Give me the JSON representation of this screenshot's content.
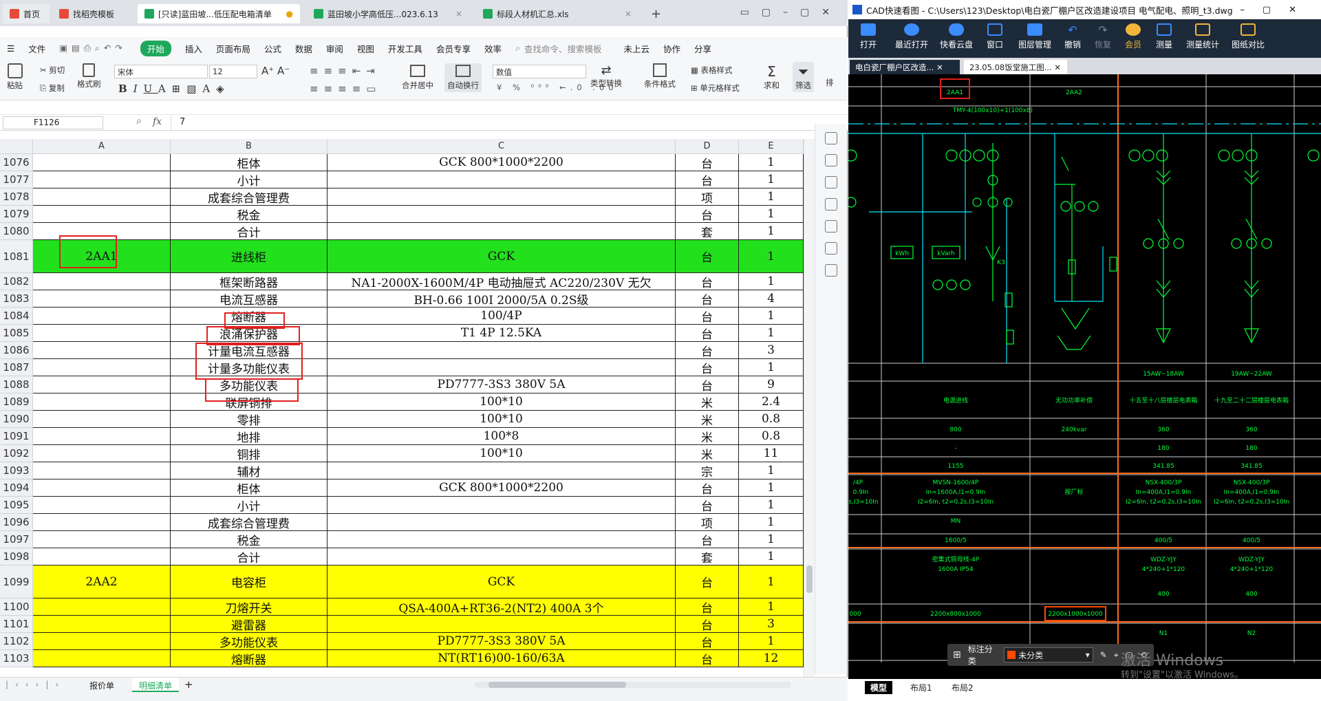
{
  "excel": {
    "tabs": [
      {
        "label": "首页",
        "color": "#e84a3a"
      },
      {
        "label": "找稻壳模板",
        "color": "#e84a3a"
      },
      {
        "label": "[只读]蓝田坡...低压配电箱清单",
        "color": "#1fa85c"
      },
      {
        "label": "蓝田坡小学高低压...023.6.13",
        "color": "#1fa85c"
      },
      {
        "label": "标段人材机汇总.xls",
        "color": "#1fa85c"
      }
    ],
    "new_tab": "+",
    "menus": [
      "文件",
      "开始",
      "插入",
      "页面布局",
      "公式",
      "数据",
      "审阅",
      "视图",
      "开发工具",
      "会员专享",
      "效率"
    ],
    "search_placeholder": "查找命令、搜索模板",
    "right_menu": [
      "未上云",
      "协作",
      "分享"
    ],
    "ribbon": {
      "paste": "粘贴",
      "cut": "剪切",
      "copy": "复制",
      "format_painter": "格式刷",
      "font": "宋体",
      "font_size": "12",
      "merge": "合并居中",
      "wrap": "自动换行",
      "number_format": "数值",
      "convert": "类型转换",
      "cond_format": "条件格式",
      "table_style": "表格样式",
      "cell_style": "单元格样式",
      "sum": "求和",
      "filter": "筛选",
      "sort": "排"
    },
    "name_box": "F1126",
    "fx": "fx",
    "formula_value": "7",
    "columns": [
      "A",
      "B",
      "C",
      "D",
      "E"
    ],
    "rows": [
      {
        "n": "1076",
        "a": "",
        "b": "柜体",
        "c": "GCK 800*1000*2200",
        "d": "台",
        "e": "1",
        "h": 1,
        "bg": ""
      },
      {
        "n": "1077",
        "a": "",
        "b": "小计",
        "c": "",
        "d": "台",
        "e": "1",
        "h": 1,
        "bg": ""
      },
      {
        "n": "1078",
        "a": "",
        "b": "成套综合管理费",
        "c": "",
        "d": "项",
        "e": "1",
        "h": 1,
        "bg": ""
      },
      {
        "n": "1079",
        "a": "",
        "b": "税金",
        "c": "",
        "d": "台",
        "e": "1",
        "h": 1,
        "bg": ""
      },
      {
        "n": "1080",
        "a": "",
        "b": "合计",
        "c": "",
        "d": "套",
        "e": "1",
        "h": 1,
        "bg": ""
      },
      {
        "n": "1081",
        "a": "2AA1",
        "b": "进线柜",
        "c": "GCK",
        "d": "台",
        "e": "1",
        "h": 2,
        "bg": "#22e01c"
      },
      {
        "n": "1082",
        "a": "",
        "b": "框架断路器",
        "c": "NA1-2000X-1600M/4P 电动抽屉式 AC220/230V 无欠",
        "d": "台",
        "e": "1",
        "h": 1,
        "bg": ""
      },
      {
        "n": "1083",
        "a": "",
        "b": "电流互感器",
        "c": "BH-0.66 100Ⅰ 2000/5A 0.2S级",
        "d": "台",
        "e": "4",
        "h": 1,
        "bg": ""
      },
      {
        "n": "1084",
        "a": "",
        "b": "熔断器",
        "c": "100/4P",
        "d": "台",
        "e": "1",
        "h": 1,
        "bg": ""
      },
      {
        "n": "1085",
        "a": "",
        "b": "浪涌保护器",
        "c": "T1 4P 12.5KA",
        "d": "台",
        "e": "1",
        "h": 1,
        "bg": ""
      },
      {
        "n": "1086",
        "a": "",
        "b": "计量电流互感器",
        "c": "",
        "d": "台",
        "e": "3",
        "h": 1,
        "bg": ""
      },
      {
        "n": "1087",
        "a": "",
        "b": "计量多功能仪表",
        "c": "",
        "d": "台",
        "e": "1",
        "h": 1,
        "bg": ""
      },
      {
        "n": "1088",
        "a": "",
        "b": "多功能仪表",
        "c": "PD7777-3S3 380V 5A",
        "d": "台",
        "e": "9",
        "h": 1,
        "bg": ""
      },
      {
        "n": "1089",
        "a": "",
        "b": "联屏铜排",
        "c": "100*10",
        "d": "米",
        "e": "2.4",
        "h": 1,
        "bg": ""
      },
      {
        "n": "1090",
        "a": "",
        "b": "零排",
        "c": "100*10",
        "d": "米",
        "e": "0.8",
        "h": 1,
        "bg": ""
      },
      {
        "n": "1091",
        "a": "",
        "b": "地排",
        "c": "100*8",
        "d": "米",
        "e": "0.8",
        "h": 1,
        "bg": ""
      },
      {
        "n": "1092",
        "a": "",
        "b": "铜排",
        "c": "100*10",
        "d": "米",
        "e": "11",
        "h": 1,
        "bg": ""
      },
      {
        "n": "1093",
        "a": "",
        "b": "辅材",
        "c": "",
        "d": "宗",
        "e": "1",
        "h": 1,
        "bg": ""
      },
      {
        "n": "1094",
        "a": "",
        "b": "柜体",
        "c": "GCK 800*1000*2200",
        "d": "台",
        "e": "1",
        "h": 1,
        "bg": ""
      },
      {
        "n": "1095",
        "a": "",
        "b": "小计",
        "c": "",
        "d": "台",
        "e": "1",
        "h": 1,
        "bg": ""
      },
      {
        "n": "1096",
        "a": "",
        "b": "成套综合管理费",
        "c": "",
        "d": "项",
        "e": "1",
        "h": 1,
        "bg": ""
      },
      {
        "n": "1097",
        "a": "",
        "b": "税金",
        "c": "",
        "d": "台",
        "e": "1",
        "h": 1,
        "bg": ""
      },
      {
        "n": "1098",
        "a": "",
        "b": "合计",
        "c": "",
        "d": "套",
        "e": "1",
        "h": 1,
        "bg": ""
      },
      {
        "n": "1099",
        "a": "2AA2",
        "b": "电容柜",
        "c": "GCK",
        "d": "台",
        "e": "1",
        "h": 2,
        "bg": "#ffff00"
      },
      {
        "n": "1100",
        "a": "",
        "b": "刀熔开关",
        "c": "QSA-400A+RT36-2(NT2) 400A 3个",
        "d": "台",
        "e": "1",
        "h": 1,
        "bg": "#ffff00"
      },
      {
        "n": "1101",
        "a": "",
        "b": "避雷器",
        "c": "",
        "d": "台",
        "e": "3",
        "h": 1,
        "bg": "#ffff00"
      },
      {
        "n": "1102",
        "a": "",
        "b": "多功能仪表",
        "c": "PD7777-3S3 380V 5A",
        "d": "台",
        "e": "1",
        "h": 1,
        "bg": "#ffff00"
      },
      {
        "n": "1103",
        "a": "",
        "b": "熔断器",
        "c": "NT(RT16)00-160/63A",
        "d": "台",
        "e": "12",
        "h": 1,
        "bg": "#ffff00"
      }
    ],
    "sheets": [
      "报价单",
      "明细清单"
    ],
    "active_sheet": "明细清单"
  },
  "cad": {
    "title": "CAD快速看图 - C:\\Users\\123\\Desktop\\电白瓷厂棚户区改造建设项目 电气配电、照明_t3.dwg",
    "tools": [
      "打开",
      "最近打开",
      "快看云盘",
      "窗口",
      "图层管理",
      "撤销",
      "恢复",
      "会员",
      "测量",
      "测量统计",
      "图纸对比"
    ],
    "tabs": [
      "电白瓷厂棚户区改造...",
      "23.05.08饭堂施工图..."
    ],
    "labels": {
      "aa1": "2AA1",
      "aa2": "2AA2",
      "busbar": "TMY-4(100x10)+1(100x8)",
      "kwh": "kWh",
      "kvarh": "kVarh",
      "k3": "K3",
      "range1": "15AW~18AW",
      "range2": "19AW~22AW",
      "use1": "电源进线",
      "use2": "无功功率补偿",
      "use3": "十五至十八层楼层电表箱",
      "use4": "十九至二十二层楼层电表箱",
      "kw1": "800",
      "kw2": "240kvar",
      "kw3": "360",
      "kw4": "360",
      "r2a": "-",
      "r2b": "180",
      "r2c": "180",
      "r3a": "1155",
      "r3b": "341.85",
      "r3c": "341.85",
      "brk1": "MVSN-1600/4P",
      "brk1b": "In=1600A,I1=0.9In",
      "brk1c": "I2=6In, t2=0.2s,I3=10In",
      "brk2": "按厂标",
      "brk3": "NSX-400/3P",
      "brk3b": "In=400A,I1=0.9In",
      "brk3c": "I2=6In, t2=0.2s,I3=10In",
      "left1": "/4P",
      "left2": "0.9In",
      "left3": "s,I3=10In",
      "mn": "MN",
      "ct1": "1600/5",
      "ct2": "400/5",
      "ct3": "400/5",
      "cable1": "密集式铜母线-4P",
      "cable1b": "1600A IP54",
      "cable2": "WDZ-YJY",
      "cable2b": "4*240+1*120",
      "cable3": "WDZ-YJY",
      "cable3b": "4*240+1*120",
      "w1": "400",
      "w2": "400",
      "left000": "000",
      "dim1": "2200x800x1000",
      "dim2": "2200x1000x1000",
      "n1": "N1",
      "n2": "N2"
    },
    "annotation_label": "标注分类",
    "annotation_value": "未分类",
    "layout_tabs": [
      "模型",
      "布局1",
      "布局2"
    ],
    "watermark1": "激活 Windows",
    "watermark2": "转到\"设置\"以激活 Windows。"
  }
}
